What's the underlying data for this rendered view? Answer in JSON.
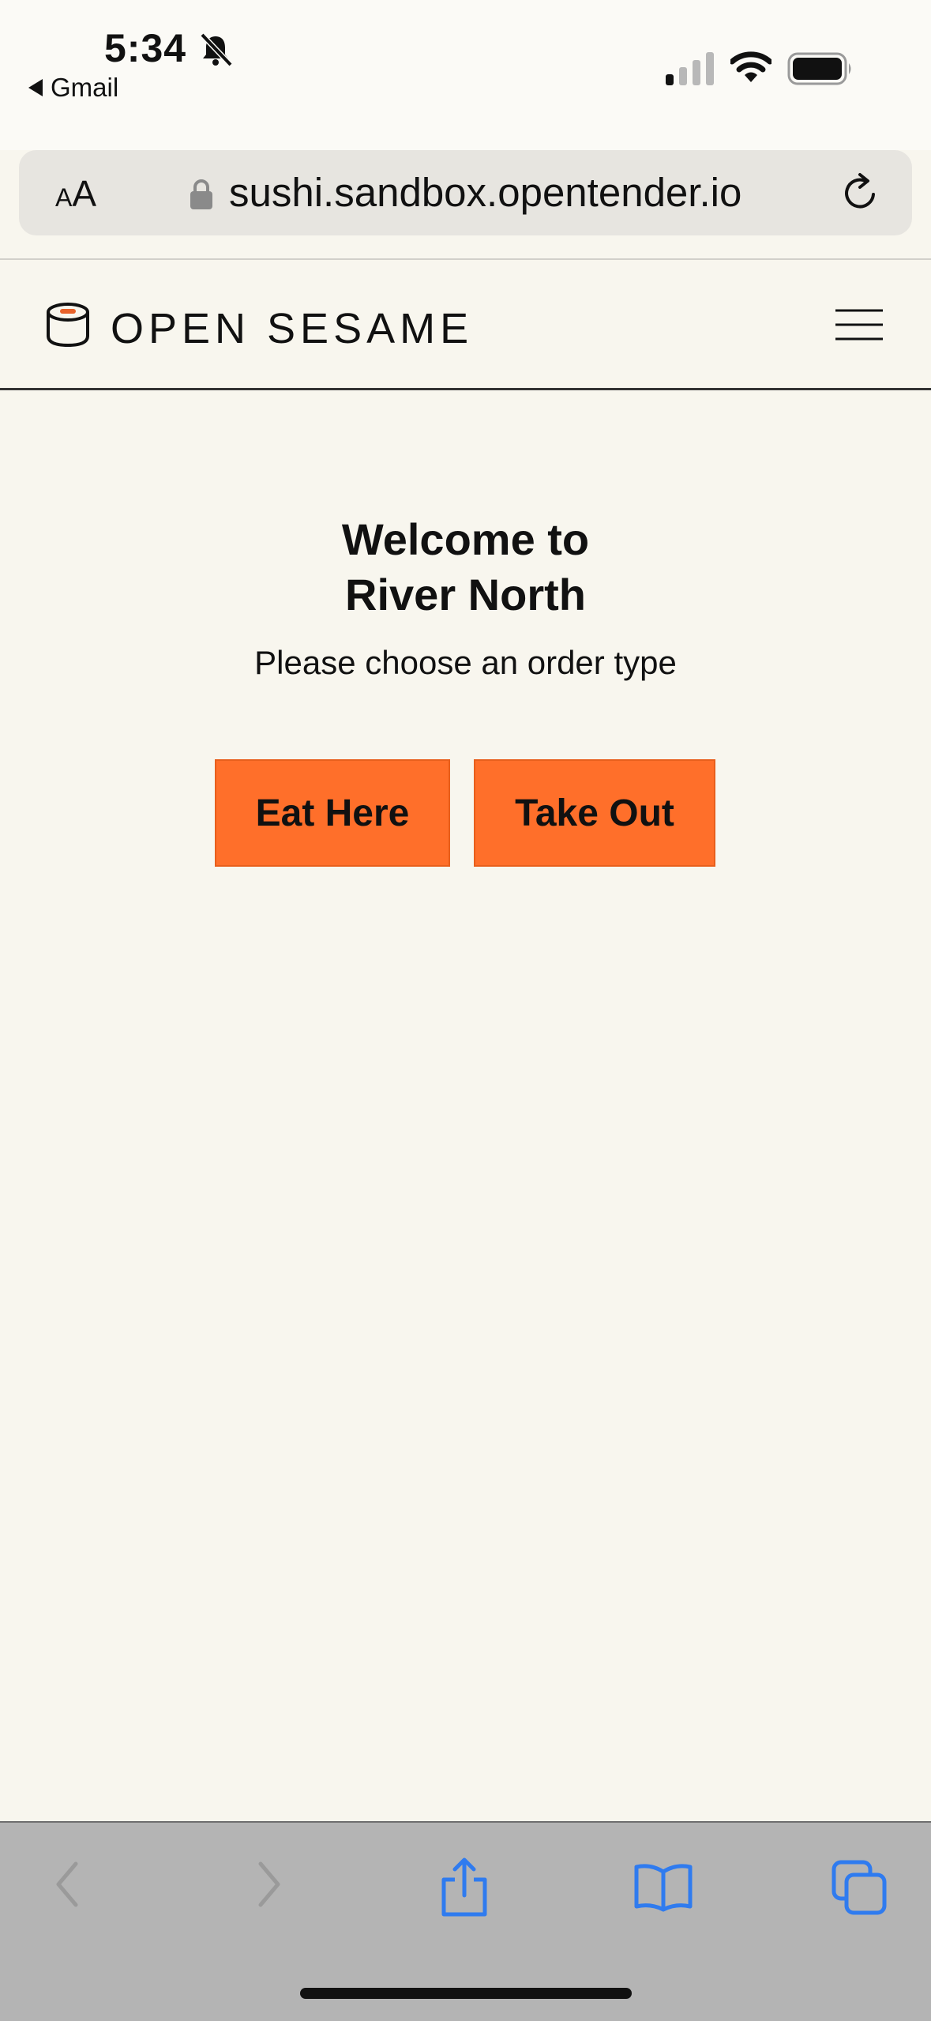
{
  "status_bar": {
    "time": "5:34",
    "back_app": "Gmail",
    "icons": [
      "bell-slash-icon",
      "signal-icon",
      "wifi-icon",
      "battery-icon"
    ]
  },
  "browser": {
    "text_size_label": "AA",
    "url": "sushi.sandbox.opentender.io",
    "icons": [
      "lock-icon",
      "reload-icon"
    ]
  },
  "site_header": {
    "brand": "OPEN SESAME",
    "icons": [
      "sushi-logo-icon",
      "hamburger-menu-icon"
    ]
  },
  "main": {
    "welcome_line1": "Welcome to",
    "welcome_line2": "River North",
    "subtitle": "Please choose an order type",
    "buttons": {
      "eat_here": "Eat Here",
      "take_out": "Take Out"
    }
  },
  "toolbar": {
    "icons": [
      "back-icon",
      "forward-icon",
      "share-icon",
      "bookmarks-icon",
      "tabs-icon"
    ]
  },
  "colors": {
    "page_bg": "#F8F6EE",
    "accent": "#FF6F2A",
    "toolbar_bg": "#B4B4B4",
    "link_blue": "#2F7BEF"
  }
}
